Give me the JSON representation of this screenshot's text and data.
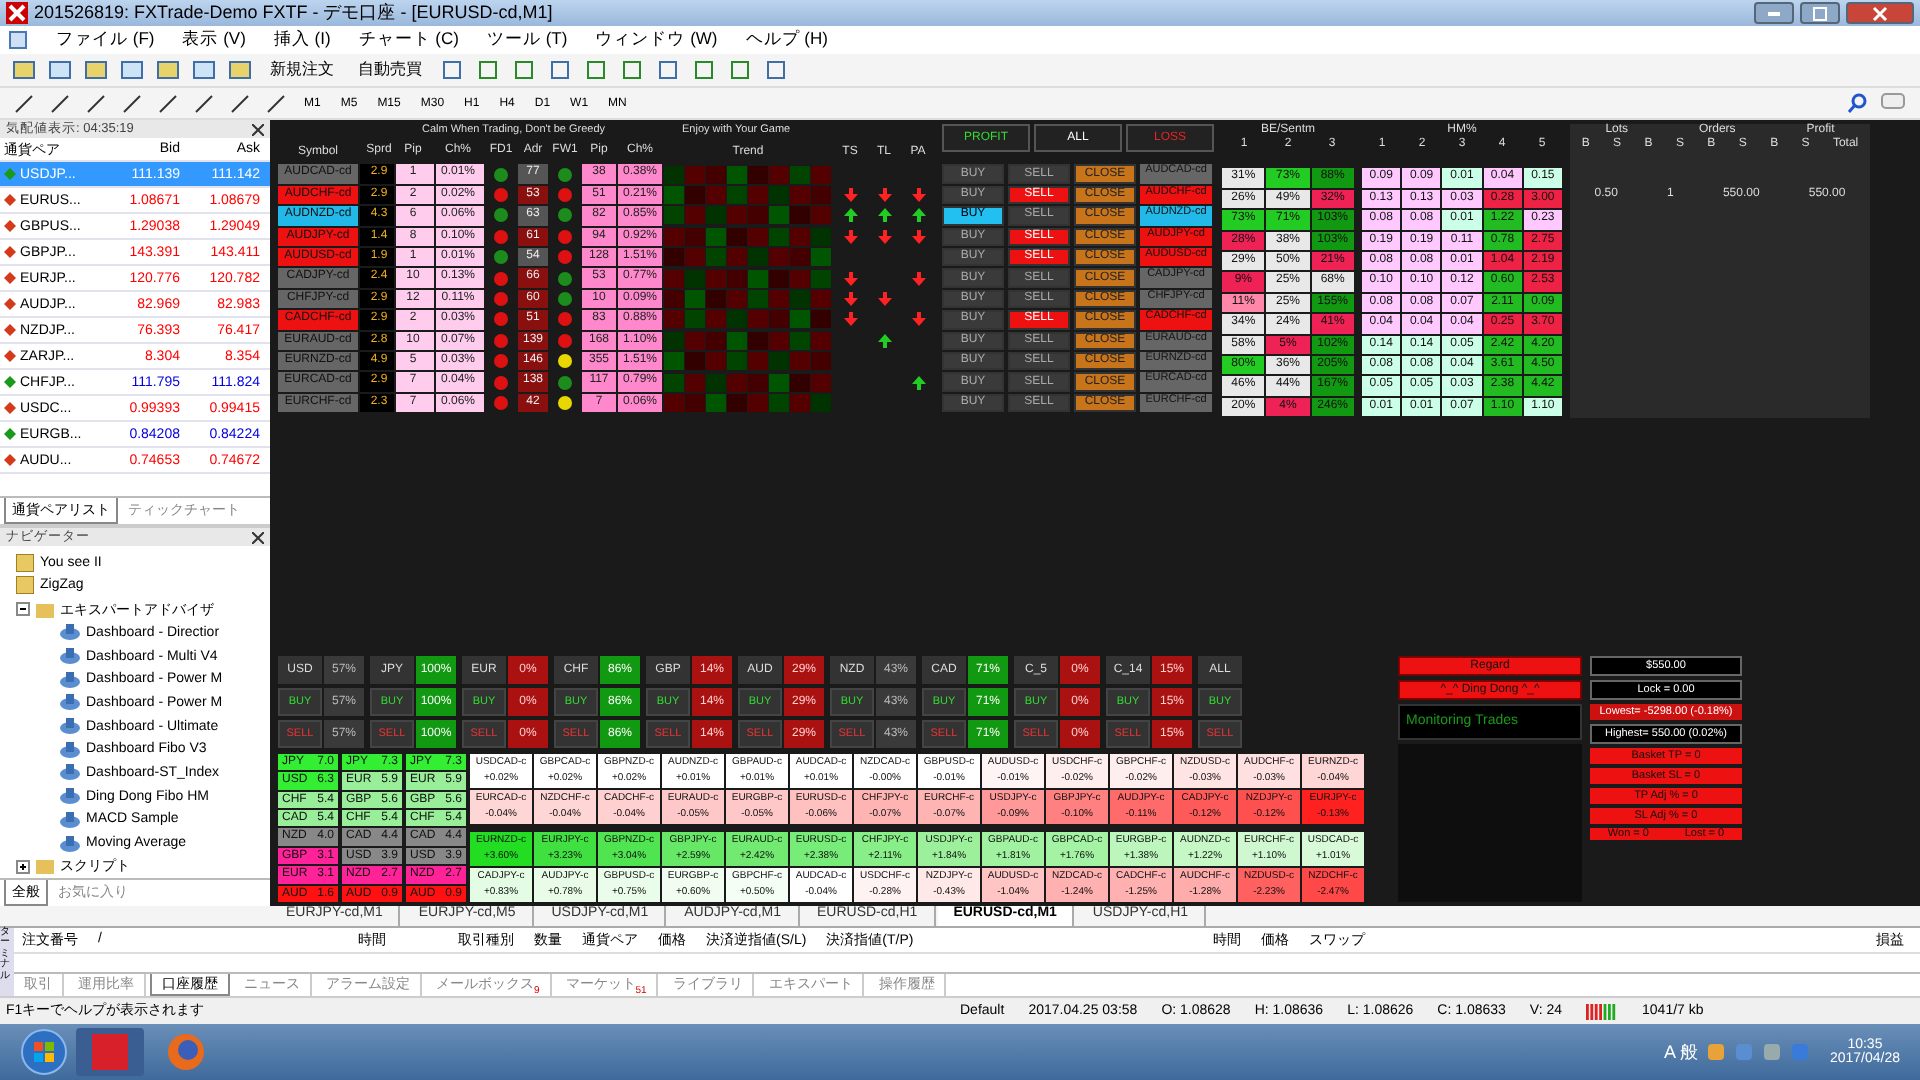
{
  "window": {
    "title": "201526819: FXTrade-Demo FXTF - デモ口座 - [EURUSD-cd,M1]"
  },
  "menu": [
    "ファイル (F)",
    "表示 (V)",
    "挿入 (I)",
    "チャート (C)",
    "ツール (T)",
    "ウィンドウ (W)",
    "ヘルプ (H)"
  ],
  "toolbar": {
    "new_order": "新規注文",
    "auto_trading": "自動売買",
    "timeframes": [
      "M1",
      "M5",
      "M15",
      "M30",
      "H1",
      "H4",
      "D1",
      "W1",
      "MN"
    ]
  },
  "market_watch": {
    "title": "気配値表示: 04:35:19",
    "columns": [
      "通貨ペア",
      "Bid",
      "Ask"
    ],
    "rows": [
      {
        "symbol": "USDJP...",
        "bid": "111.139",
        "ask": "111.142",
        "color": "#1a9a1a",
        "selected": true
      },
      {
        "symbol": "EURUS...",
        "bid": "1.08671",
        "ask": "1.08679",
        "color": "#d43a1a",
        "selected": false
      },
      {
        "symbol": "GBPUS...",
        "bid": "1.29038",
        "ask": "1.29049",
        "color": "#d43a1a",
        "selected": false
      },
      {
        "symbol": "GBPJP...",
        "bid": "143.391",
        "ask": "143.411",
        "color": "#d43a1a",
        "selected": false
      },
      {
        "symbol": "EURJP...",
        "bid": "120.776",
        "ask": "120.782",
        "color": "#d43a1a",
        "selected": false
      },
      {
        "symbol": "AUDJP...",
        "bid": "82.969",
        "ask": "82.983",
        "color": "#d43a1a",
        "selected": false
      },
      {
        "symbol": "NZDJP...",
        "bid": "76.393",
        "ask": "76.417",
        "color": "#d43a1a",
        "selected": false
      },
      {
        "symbol": "ZARJP...",
        "bid": "8.304",
        "ask": "8.354",
        "color": "#d43a1a",
        "selected": false
      },
      {
        "symbol": "CHFJP...",
        "bid": "111.795",
        "ask": "111.824",
        "color": "#1a9a1a",
        "selected": false
      },
      {
        "symbol": "USDC...",
        "bid": "0.99393",
        "ask": "0.99415",
        "color": "#d43a1a",
        "selected": false
      },
      {
        "symbol": "EURGB...",
        "bid": "0.84208",
        "ask": "0.84224",
        "color": "#1a9a1a",
        "selected": false
      },
      {
        "symbol": "AUDU...",
        "bid": "0.74653",
        "ask": "0.74672",
        "color": "#d43a1a",
        "selected": false
      }
    ],
    "tabs": [
      {
        "label": "通貨ペアリスト",
        "selected": true
      },
      {
        "label": "ティックチャート",
        "selected": false
      }
    ]
  },
  "navigator": {
    "title": "ナビゲーター",
    "items": [
      {
        "label": "You see II",
        "kind": "indicator"
      },
      {
        "label": "ZigZag",
        "kind": "indicator"
      },
      {
        "label": "エキスパートアドバイザ",
        "kind": "folder",
        "expanded": true,
        "children": [
          {
            "label": "Dashboard - Directior",
            "kind": "expert"
          },
          {
            "label": "Dashboard - Multi V4",
            "kind": "expert"
          },
          {
            "label": "Dashboard - Power M",
            "kind": "expert"
          },
          {
            "label": "Dashboard - Power M",
            "kind": "expert"
          },
          {
            "label": "Dashboard - Ultimate",
            "kind": "expert"
          },
          {
            "label": "Dashboard Fibo V3",
            "kind": "expert"
          },
          {
            "label": "Dashboard-ST_Index",
            "kind": "expert"
          },
          {
            "label": "Ding Dong Fibo HM",
            "kind": "expert"
          },
          {
            "label": "MACD Sample",
            "kind": "expert"
          },
          {
            "label": "Moving Average",
            "kind": "expert"
          }
        ]
      },
      {
        "label": "スクリプト",
        "kind": "folder",
        "expanded": false
      }
    ],
    "tabs": [
      {
        "label": "全般",
        "selected": true
      },
      {
        "label": "お気に入り",
        "selected": false
      }
    ]
  },
  "dashboard": {
    "motto_1": "Calm When Trading, Don't be Greedy",
    "motto_2": "Enjoy with Your Game",
    "columns": [
      "Symbol",
      "Sprd",
      "Pip",
      "Ch%",
      "FD1",
      "Adr",
      "FW1",
      "Pip",
      "Ch%",
      "Trend",
      "TS",
      "TL",
      "PA"
    ],
    "actions": [
      "PROFIT",
      "ALL",
      "LOSS"
    ],
    "be_header": "BE/Sentm",
    "be_cols": [
      "1",
      "2",
      "3"
    ],
    "hm_header": "HM%",
    "hm_cols": [
      "1",
      "2",
      "3",
      "4",
      "5"
    ],
    "rows": [
      {
        "symbol": "AUDCAD-cd",
        "symbol_right": "AUDCAD-cd",
        "buttons": [
          "BUY",
          "SELL",
          "CLOSE"
        ],
        "color": "#666666",
        "sprd": "2.9",
        "pip": "1",
        "ch": "0.01%",
        "fd1": {
          "color": "#1c8c1c"
        },
        "adr": "77",
        "fw1": {
          "color": "#1c8c1c"
        },
        "pip2": "38",
        "ch2": "0.38%",
        "be": [
          {
            "text": "31%",
            "color": "#e8e8e8"
          },
          {
            "text": "73%",
            "color": "#22cc22"
          },
          {
            "text": "88%",
            "color": "#119911"
          }
        ],
        "hm": [
          {
            "text": "0.09",
            "color": "#ffc8ff"
          },
          {
            "text": "0.09",
            "color": "#ffc8ff"
          },
          {
            "text": "0.01",
            "color": "#ccffe8"
          },
          {
            "text": "0.04",
            "color": "#ffc8ff"
          },
          {
            "text": "0.15",
            "color": "#ccffe8"
          }
        ]
      },
      {
        "symbol": "AUDCHF-cd",
        "symbol_right": "AUDCHF-cd",
        "buttons": [
          "BUY",
          "SELL",
          "CLOSE"
        ],
        "color": "#ee1111",
        "sprd": "2.9",
        "pip": "2",
        "ch": "0.02%",
        "fd1": {
          "color": "#dd1111"
        },
        "adr": "53",
        "fw1": {
          "color": "#dd1111"
        },
        "pip2": "51",
        "ch2": "0.21%",
        "ts": {
          "kind": "fall"
        },
        "tl": {
          "kind": "fall"
        },
        "pa": {
          "kind": "fall"
        },
        "be": [
          {
            "text": "26%",
            "color": "#e8e8e8"
          },
          {
            "text": "49%",
            "color": "#e8e8e8"
          },
          {
            "text": "32%",
            "color": "#ee2255"
          }
        ],
        "hm": [
          {
            "text": "0.13",
            "color": "#ffc8ff"
          },
          {
            "text": "0.13",
            "color": "#ffc8ff"
          },
          {
            "text": "0.03",
            "color": "#ffc8ff"
          },
          {
            "text": "0.28",
            "color": "#ee2244"
          },
          {
            "text": "3.00",
            "color": "#ee2244"
          }
        ]
      },
      {
        "symbol": "AUDNZD-cd",
        "symbol_right": "AUDNZD-cd",
        "buttons": [
          "BUY",
          "SELL",
          "CLOSE"
        ],
        "color": "#22b8e8",
        "sprd": "4.3",
        "pip": "6",
        "ch": "0.06%",
        "fd1": {
          "color": "#1c8c1c"
        },
        "adr": "63",
        "fw1": {
          "color": "#1c8c1c"
        },
        "pip2": "82",
        "ch2": "0.85%",
        "ts": {
          "kind": "rise"
        },
        "tl": {
          "kind": "rise"
        },
        "pa": {
          "kind": "rise"
        },
        "be": [
          {
            "text": "73%",
            "color": "#22cc22"
          },
          {
            "text": "71%",
            "color": "#22cc22"
          },
          {
            "text": "103%",
            "color": "#119911"
          }
        ],
        "hm": [
          {
            "text": "0.08",
            "color": "#ffc8ff"
          },
          {
            "text": "0.08",
            "color": "#ffc8ff"
          },
          {
            "text": "0.01",
            "color": "#ccffe8"
          },
          {
            "text": "1.22",
            "color": "#22bb22"
          },
          {
            "text": "0.23",
            "color": "#ffc8ff"
          }
        ]
      },
      {
        "symbol": "AUDJPY-cd",
        "symbol_right": "AUDJPY-cd",
        "buttons": [
          "BUY",
          "SELL",
          "CLOSE"
        ],
        "color": "#ee1111",
        "sprd": "1.4",
        "pip": "8",
        "ch": "0.10%",
        "fd1": {
          "color": "#dd1111"
        },
        "adr": "61",
        "fw1": {
          "color": "#dd1111"
        },
        "pip2": "94",
        "ch2": "0.92%",
        "ts": {
          "kind": "fall"
        },
        "tl": {
          "kind": "fall"
        },
        "pa": {
          "kind": "fall"
        },
        "be": [
          {
            "text": "28%",
            "color": "#ee2255"
          },
          {
            "text": "38%",
            "color": "#e8e8e8"
          },
          {
            "text": "103%",
            "color": "#119911"
          }
        ],
        "hm": [
          {
            "text": "0.19",
            "color": "#ffc8ff"
          },
          {
            "text": "0.19",
            "color": "#ffc8ff"
          },
          {
            "text": "0.11",
            "color": "#ffc8ff"
          },
          {
            "text": "0.78",
            "color": "#22bb22"
          },
          {
            "text": "2.75",
            "color": "#ee2244"
          }
        ]
      },
      {
        "symbol": "AUDUSD-cd",
        "symbol_right": "AUDUSD-cd",
        "buttons": [
          "BUY",
          "SELL",
          "CLOSE"
        ],
        "color": "#ee1111",
        "sprd": "1.9",
        "pip": "1",
        "ch": "0.01%",
        "fd1": {
          "color": "#1c8c1c"
        },
        "adr": "54",
        "fw1": {
          "color": "#dd1111"
        },
        "pip2": "128",
        "ch2": "1.51%",
        "be": [
          {
            "text": "29%",
            "color": "#e8e8e8"
          },
          {
            "text": "50%",
            "color": "#e8e8e8"
          },
          {
            "text": "21%",
            "color": "#ee2255"
          }
        ],
        "hm": [
          {
            "text": "0.08",
            "color": "#ffc8ff"
          },
          {
            "text": "0.08",
            "color": "#ffc8ff"
          },
          {
            "text": "0.01",
            "color": "#ffc8ff"
          },
          {
            "text": "1.04",
            "color": "#ee2244"
          },
          {
            "text": "2.19",
            "color": "#ee2244"
          }
        ]
      },
      {
        "symbol": "CADJPY-cd",
        "symbol_right": "CADJPY-cd",
        "buttons": [
          "BUY",
          "SELL",
          "CLOSE"
        ],
        "color": "#666666",
        "sprd": "2.4",
        "pip": "10",
        "ch": "0.13%",
        "fd1": {
          "color": "#dd1111"
        },
        "adr": "66",
        "fw1": {
          "color": "#1c8c1c"
        },
        "pip2": "53",
        "ch2": "0.77%",
        "ts": {
          "kind": "fall"
        },
        "pa": {
          "kind": "fall"
        },
        "be": [
          {
            "text": "9%",
            "color": "#ee2255"
          },
          {
            "text": "25%",
            "color": "#e8e8e8"
          },
          {
            "text": "68%",
            "color": "#e8e8e8"
          }
        ],
        "hm": [
          {
            "text": "0.10",
            "color": "#ffc8ff"
          },
          {
            "text": "0.10",
            "color": "#ffc8ff"
          },
          {
            "text": "0.12",
            "color": "#ffc8ff"
          },
          {
            "text": "0.60",
            "color": "#22bb22"
          },
          {
            "text": "2.53",
            "color": "#ee2244"
          }
        ]
      },
      {
        "symbol": "CHFJPY-cd",
        "symbol_right": "CHFJPY-cd",
        "buttons": [
          "BUY",
          "SELL",
          "CLOSE"
        ],
        "color": "#666666",
        "sprd": "2.9",
        "pip": "12",
        "ch": "0.11%",
        "fd1": {
          "color": "#dd1111"
        },
        "adr": "60",
        "fw1": {
          "color": "#1c8c1c"
        },
        "pip2": "10",
        "ch2": "0.09%",
        "ts": {
          "kind": "fall"
        },
        "tl": {
          "kind": "fall"
        },
        "be": [
          {
            "text": "11%",
            "color": "#ff88aa"
          },
          {
            "text": "25%",
            "color": "#e8e8e8"
          },
          {
            "text": "155%",
            "color": "#119911"
          }
        ],
        "hm": [
          {
            "text": "0.08",
            "color": "#ffc8ff"
          },
          {
            "text": "0.08",
            "color": "#ffc8ff"
          },
          {
            "text": "0.07",
            "color": "#ffc8ff"
          },
          {
            "text": "2.11",
            "color": "#22bb22"
          },
          {
            "text": "0.09",
            "color": "#22bb22"
          }
        ]
      },
      {
        "symbol": "CADCHF-cd",
        "symbol_right": "CADCHF-cd",
        "buttons": [
          "BUY",
          "SELL",
          "CLOSE"
        ],
        "color": "#ee1111",
        "sprd": "2.9",
        "pip": "2",
        "ch": "0.03%",
        "fd1": {
          "color": "#dd1111"
        },
        "adr": "51",
        "fw1": {
          "color": "#dd1111"
        },
        "pip2": "83",
        "ch2": "0.88%",
        "ts": {
          "kind": "fall"
        },
        "pa": {
          "kind": "fall"
        },
        "be": [
          {
            "text": "34%",
            "color": "#e8e8e8"
          },
          {
            "text": "24%",
            "color": "#e8e8e8"
          },
          {
            "text": "41%",
            "color": "#ee2255"
          }
        ],
        "hm": [
          {
            "text": "0.04",
            "color": "#ffc8ff"
          },
          {
            "text": "0.04",
            "color": "#ffc8ff"
          },
          {
            "text": "0.04",
            "color": "#ffc8ff"
          },
          {
            "text": "0.25",
            "color": "#ee2244"
          },
          {
            "text": "3.70",
            "color": "#ee2244"
          }
        ]
      },
      {
        "symbol": "EURAUD-cd",
        "symbol_right": "EURAUD-cd",
        "buttons": [
          "BUY",
          "SELL",
          "CLOSE"
        ],
        "color": "#666666",
        "sprd": "2.8",
        "pip": "10",
        "ch": "0.07%",
        "fd1": {
          "color": "#dd1111"
        },
        "adr": "139",
        "fw1": {
          "color": "#dd1111"
        },
        "pip2": "168",
        "ch2": "1.10%",
        "tl": {
          "kind": "rise"
        },
        "be": [
          {
            "text": "58%",
            "color": "#e8e8e8"
          },
          {
            "text": "5%",
            "color": "#ee2255"
          },
          {
            "text": "102%",
            "color": "#119911"
          }
        ],
        "hm": [
          {
            "text": "0.14",
            "color": "#ccffe8"
          },
          {
            "text": "0.14",
            "color": "#ccffe8"
          },
          {
            "text": "0.05",
            "color": "#ccffe8"
          },
          {
            "text": "2.42",
            "color": "#22bb22"
          },
          {
            "text": "4.20",
            "color": "#22bb22"
          }
        ]
      },
      {
        "symbol": "EURNZD-cd",
        "symbol_right": "EURNZD-cd",
        "buttons": [
          "BUY",
          "SELL",
          "CLOSE"
        ],
        "color": "#666666",
        "sprd": "4.9",
        "pip": "5",
        "ch": "0.03%",
        "fd1": {
          "color": "#dd1111"
        },
        "adr": "146",
        "fw1": {
          "color": "#e8d800"
        },
        "pip2": "355",
        "ch2": "1.51%",
        "be": [
          {
            "text": "80%",
            "color": "#22cc22"
          },
          {
            "text": "36%",
            "color": "#e8e8e8"
          },
          {
            "text": "205%",
            "color": "#119911"
          }
        ],
        "hm": [
          {
            "text": "0.08",
            "color": "#ccffe8"
          },
          {
            "text": "0.08",
            "color": "#ccffe8"
          },
          {
            "text": "0.04",
            "color": "#ccffe8"
          },
          {
            "text": "3.61",
            "color": "#22bb22"
          },
          {
            "text": "4.50",
            "color": "#22bb22"
          }
        ]
      },
      {
        "symbol": "EURCAD-cd",
        "symbol_right": "EURCAD-cd",
        "buttons": [
          "BUY",
          "SELL",
          "CLOSE"
        ],
        "color": "#666666",
        "sprd": "2.9",
        "pip": "7",
        "ch": "0.04%",
        "fd1": {
          "color": "#dd1111"
        },
        "adr": "138",
        "fw1": {
          "color": "#1c8c1c"
        },
        "pip2": "117",
        "ch2": "0.79%",
        "pa": {
          "kind": "rise"
        },
        "be": [
          {
            "text": "46%",
            "color": "#e8e8e8"
          },
          {
            "text": "44%",
            "color": "#e8e8e8"
          },
          {
            "text": "167%",
            "color": "#119911"
          }
        ],
        "hm": [
          {
            "text": "0.05",
            "color": "#ccffe8"
          },
          {
            "text": "0.05",
            "color": "#ccffe8"
          },
          {
            "text": "0.03",
            "color": "#ccffe8"
          },
          {
            "text": "2.38",
            "color": "#22bb22"
          },
          {
            "text": "4.42",
            "color": "#22bb22"
          }
        ]
      },
      {
        "symbol": "EURCHF-cd",
        "symbol_right": "EURCHF-cd",
        "buttons": [
          "BUY",
          "SELL",
          "CLOSE"
        ],
        "color": "#666666",
        "sprd": "2.3",
        "pip": "7",
        "ch": "0.06%",
        "fd1": {
          "color": "#dd1111"
        },
        "adr": "42",
        "fw1": {
          "color": "#e8d800"
        },
        "pip2": "7",
        "ch2": "0.06%",
        "be": [
          {
            "text": "20%",
            "color": "#e8e8e8"
          },
          {
            "text": "4%",
            "color": "#ee2255"
          },
          {
            "text": "246%",
            "color": "#119911"
          }
        ],
        "hm": [
          {
            "text": "0.01",
            "color": "#ccffe8"
          },
          {
            "text": "0.01",
            "color": "#ccffe8"
          },
          {
            "text": "0.07",
            "color": "#ccffe8"
          },
          {
            "text": "1.10",
            "color": "#22bb22"
          },
          {
            "text": "1.10",
            "color": "#ccffe8"
          }
        ]
      }
    ],
    "account_headers": {
      "lots": "Lots",
      "orders": "Orders",
      "profit": "Profit",
      "total": "Total",
      "sides": [
        "B",
        "S",
        "B",
        "S",
        "B",
        "S",
        "B",
        "S"
      ]
    },
    "account_row": {
      "lots": "0.50",
      "orders": "1",
      "profit": "550.00",
      "total": "550.00"
    },
    "strength": [
      {
        "currency": "USD",
        "values": [
          "57%",
          "57%",
          "57%"
        ],
        "color": "#3a3a3a",
        "buttons": [
          "BUY",
          "SELL"
        ]
      },
      {
        "currency": "JPY",
        "values": [
          "100%",
          "100%",
          "100%"
        ],
        "color": "#119911",
        "buttons": [
          "BUY",
          "SELL"
        ]
      },
      {
        "currency": "EUR",
        "values": [
          "0%",
          "0%",
          "0%"
        ],
        "color": "#aa1111",
        "buttons": [
          "BUY",
          "SELL"
        ]
      },
      {
        "currency": "CHF",
        "values": [
          "86%",
          "86%",
          "86%"
        ],
        "color": "#119911",
        "buttons": [
          "BUY",
          "SELL"
        ]
      },
      {
        "currency": "GBP",
        "values": [
          "14%",
          "14%",
          "14%"
        ],
        "color": "#aa1111",
        "buttons": [
          "BUY",
          "SELL"
        ]
      },
      {
        "currency": "AUD",
        "values": [
          "29%",
          "29%",
          "29%"
        ],
        "color": "#aa1111",
        "buttons": [
          "BUY",
          "SELL"
        ]
      },
      {
        "currency": "NZD",
        "values": [
          "43%",
          "43%",
          "43%"
        ],
        "color": "#3a3a3a",
        "buttons": [
          "BUY",
          "SELL"
        ]
      },
      {
        "currency": "CAD",
        "values": [
          "71%",
          "71%",
          "71%"
        ],
        "color": "#119911",
        "buttons": [
          "BUY",
          "SELL"
        ]
      },
      {
        "currency": "C_5",
        "values": [
          "0%",
          "0%",
          "0%"
        ],
        "color": "#aa1111",
        "buttons": [
          "BUY",
          "SELL"
        ]
      },
      {
        "currency": "C_14",
        "values": [
          "15%",
          "15%",
          "15%"
        ],
        "color": "#aa1111",
        "buttons": [
          "BUY",
          "SELL"
        ]
      }
    ],
    "all_group": {
      "label": "ALL",
      "buttons": [
        "BUY",
        "SELL"
      ]
    },
    "side_buttons": [
      {
        "label": "Regard",
        "kind": "alert"
      },
      {
        "label": "^_^ Ding Dong ^_^",
        "kind": "alert"
      },
      {
        "label": "Monitoring Trades",
        "kind": "status"
      }
    ],
    "ranking": [
      [
        {
          "cur": "JPY",
          "val": "7.0",
          "color": "#33ee33"
        },
        {
          "cur": "USD",
          "val": "6.3",
          "color": "#33ee33"
        },
        {
          "cur": "CHF",
          "val": "5.4",
          "color": "#99ee99"
        },
        {
          "cur": "CAD",
          "val": "5.4",
          "color": "#99ee99"
        },
        {
          "cur": "NZD",
          "val": "4.0",
          "color": "#888888"
        },
        {
          "cur": "GBP",
          "val": "3.1",
          "color": "#ff2299"
        },
        {
          "cur": "EUR",
          "val": "3.1",
          "color": "#ff2299"
        },
        {
          "cur": "AUD",
          "val": "1.6",
          "color": "#ff1111"
        }
      ],
      [
        {
          "cur": "JPY",
          "val": "7.3",
          "color": "#33ee33"
        },
        {
          "cur": "EUR",
          "val": "5.9",
          "color": "#99ee99"
        },
        {
          "cur": "GBP",
          "val": "5.6",
          "color": "#99ee99"
        },
        {
          "cur": "CHF",
          "val": "5.4",
          "color": "#99ee99"
        },
        {
          "cur": "CAD",
          "val": "4.4",
          "color": "#888888"
        },
        {
          "cur": "USD",
          "val": "3.9",
          "color": "#888888"
        },
        {
          "cur": "NZD",
          "val": "2.7",
          "color": "#ff2299"
        },
        {
          "cur": "AUD",
          "val": "0.9",
          "color": "#ff1111"
        }
      ],
      [
        {
          "cur": "JPY",
          "val": "7.3",
          "color": "#33ee33"
        },
        {
          "cur": "EUR",
          "val": "5.9",
          "color": "#99ee99"
        },
        {
          "cur": "GBP",
          "val": "5.6",
          "color": "#99ee99"
        },
        {
          "cur": "CHF",
          "val": "5.4",
          "color": "#99ee99"
        },
        {
          "cur": "CAD",
          "val": "4.4",
          "color": "#888888"
        },
        {
          "cur": "USD",
          "val": "3.9",
          "color": "#888888"
        },
        {
          "cur": "NZD",
          "val": "2.7",
          "color": "#ff2299"
        },
        {
          "cur": "AUD",
          "val": "0.9",
          "color": "#ff1111"
        }
      ]
    ],
    "pair_grid": [
      [
        {
          "pair": "USDCAD-c",
          "chg": "+0.02%",
          "color": "#ffffff"
        },
        {
          "pair": "GBPCAD-c",
          "chg": "+0.02%",
          "color": "#ffffff"
        },
        {
          "pair": "GBPNZD-c",
          "chg": "+0.02%",
          "color": "#ffffff"
        },
        {
          "pair": "AUDNZD-c",
          "chg": "+0.01%",
          "color": "#ffffff"
        },
        {
          "pair": "GBPAUD-c",
          "chg": "+0.01%",
          "color": "#ffffff"
        },
        {
          "pair": "AUDCAD-c",
          "chg": "+0.01%",
          "color": "#ffffff"
        },
        {
          "pair": "NZDCAD-c",
          "chg": "-0.00%",
          "color": "#ffffff"
        },
        {
          "pair": "GBPUSD-c",
          "chg": "-0.01%",
          "color": "#ffffff"
        },
        {
          "pair": "AUDUSD-c",
          "chg": "-0.01%",
          "color": "#fff4f4"
        },
        {
          "pair": "USDCHF-c",
          "chg": "-0.02%",
          "color": "#ffeeee"
        },
        {
          "pair": "GBPCHF-c",
          "chg": "-0.02%",
          "color": "#ffeeee"
        },
        {
          "pair": "NZDUSD-c",
          "chg": "-0.03%",
          "color": "#ffe4e4"
        },
        {
          "pair": "AUDCHF-c",
          "chg": "-0.03%",
          "color": "#ffe0e0"
        },
        {
          "pair": "EURNZD-c",
          "chg": "-0.04%",
          "color": "#ffd6d6"
        }
      ],
      [
        {
          "pair": "EURCAD-c",
          "chg": "-0.04%",
          "color": "#ffd6d6"
        },
        {
          "pair": "NZDCHF-c",
          "chg": "-0.04%",
          "color": "#ffd6d6"
        },
        {
          "pair": "CADCHF-c",
          "chg": "-0.04%",
          "color": "#ffd0d0"
        },
        {
          "pair": "EURAUD-c",
          "chg": "-0.05%",
          "color": "#ffc8c8"
        },
        {
          "pair": "EURGBP-c",
          "chg": "-0.05%",
          "color": "#ffc8c8"
        },
        {
          "pair": "EURUSD-c",
          "chg": "-0.06%",
          "color": "#ffc0c0"
        },
        {
          "pair": "CHFJPY-c",
          "chg": "-0.07%",
          "color": "#ffb4b4"
        },
        {
          "pair": "EURCHF-c",
          "chg": "-0.07%",
          "color": "#ffb4b4"
        },
        {
          "pair": "USDJPY-c",
          "chg": "-0.09%",
          "color": "#ff9898"
        },
        {
          "pair": "GBPJPY-c",
          "chg": "-0.10%",
          "color": "#ff8080"
        },
        {
          "pair": "AUDJPY-c",
          "chg": "-0.11%",
          "color": "#ff6a6a"
        },
        {
          "pair": "CADJPY-c",
          "chg": "-0.12%",
          "color": "#ff5a5a"
        },
        {
          "pair": "NZDJPY-c",
          "chg": "-0.12%",
          "color": "#ff5050"
        },
        {
          "pair": "EURJPY-c",
          "chg": "-0.13%",
          "color": "#ff2020"
        }
      ],
      [
        {
          "pair": "EURNZD-c",
          "chg": "+3.60%",
          "color": "#22dd22"
        },
        {
          "pair": "EURJPY-c",
          "chg": "+3.23%",
          "color": "#40e040"
        },
        {
          "pair": "GBPNZD-c",
          "chg": "+3.04%",
          "color": "#50e450"
        },
        {
          "pair": "GBPJPY-c",
          "chg": "+2.59%",
          "color": "#66e866"
        },
        {
          "pair": "EURAUD-c",
          "chg": "+2.42%",
          "color": "#72ea72"
        },
        {
          "pair": "EURUSD-c",
          "chg": "+2.38%",
          "color": "#78ec78"
        },
        {
          "pair": "CHFJPY-c",
          "chg": "+2.11%",
          "color": "#88ee88"
        },
        {
          "pair": "USDJPY-c",
          "chg": "+1.84%",
          "color": "#9cf09c"
        },
        {
          "pair": "GBPAUD-c",
          "chg": "+1.81%",
          "color": "#a0f2a0"
        },
        {
          "pair": "GBPCAD-c",
          "chg": "+1.76%",
          "color": "#a4f2a4"
        },
        {
          "pair": "EURGBP-c",
          "chg": "+1.38%",
          "color": "#bcf6bc"
        },
        {
          "pair": "AUDNZD-c",
          "chg": "+1.22%",
          "color": "#c6f8c6"
        },
        {
          "pair": "EURCHF-c",
          "chg": "+1.10%",
          "color": "#d0f8d0"
        },
        {
          "pair": "USDCAD-c",
          "chg": "+1.01%",
          "color": "#d8fad8"
        }
      ],
      [
        {
          "pair": "CADJPY-c",
          "chg": "+0.83%",
          "color": "#e4fce4"
        },
        {
          "pair": "AUDJPY-c",
          "chg": "+0.78%",
          "color": "#e8fce8"
        },
        {
          "pair": "GBPUSD-c",
          "chg": "+0.75%",
          "color": "#eafcea"
        },
        {
          "pair": "EURGBP-c",
          "chg": "+0.60%",
          "color": "#f0fdf0"
        },
        {
          "pair": "GBPCHF-c",
          "chg": "+0.50%",
          "color": "#f4fef4"
        },
        {
          "pair": "AUDCAD-c",
          "chg": "-0.04%",
          "color": "#ffffff"
        },
        {
          "pair": "USDCHF-c",
          "chg": "-0.28%",
          "color": "#fff2f2"
        },
        {
          "pair": "NZDJPY-c",
          "chg": "-0.43%",
          "color": "#ffe8e8"
        },
        {
          "pair": "AUDUSD-c",
          "chg": "-1.04%",
          "color": "#ffc4c4"
        },
        {
          "pair": "NZDCAD-c",
          "chg": "-1.24%",
          "color": "#ffb0b0"
        },
        {
          "pair": "CADCHF-c",
          "chg": "-1.25%",
          "color": "#ffb0b0"
        },
        {
          "pair": "AUDCHF-c",
          "chg": "-1.28%",
          "color": "#ffacac"
        },
        {
          "pair": "NZDUSD-c",
          "chg": "-2.23%",
          "color": "#ff6060"
        },
        {
          "pair": "NZDCHF-c",
          "chg": "-2.47%",
          "color": "#ff4848"
        }
      ]
    ],
    "summary": [
      {
        "text": "$550.00",
        "kind": "box"
      },
      {
        "text": "Lock = 0.00",
        "kind": "box"
      },
      {
        "text": "Lowest= -5298.00 (-0.18%)",
        "kind": "loss"
      },
      {
        "text": "Highest= 550.00 (0.02%)",
        "kind": "box"
      },
      {
        "text": "Basket TP = 0",
        "kind": "alert"
      },
      {
        "text": "Basket SL = 0",
        "kind": "alert"
      },
      {
        "text": "TP Adj % = 0",
        "kind": "alert"
      },
      {
        "text": "SL Adj % = 0",
        "kind": "alert"
      }
    ],
    "won": "Won = 0",
    "lost": "Lost = 0"
  },
  "chart_tabs": [
    {
      "label": "EURJPY-cd,M1",
      "selected": false
    },
    {
      "label": "EURJPY-cd,M5",
      "selected": false
    },
    {
      "label": "USDJPY-cd,M1",
      "selected": false
    },
    {
      "label": "AUDJPY-cd,M1",
      "selected": false
    },
    {
      "label": "EURUSD-cd,H1",
      "selected": false
    },
    {
      "label": "EURUSD-cd,M1",
      "selected": true
    },
    {
      "label": "USDJPY-cd,H1",
      "selected": false
    }
  ],
  "terminal": {
    "side_label": "ターミナル",
    "columns": [
      "注文番号",
      "/",
      "時間",
      "取引種別",
      "数量",
      "通貨ペア",
      "価格",
      "決済逆指値(S/L)",
      "決済指値(T/P)",
      "時間",
      "価格",
      "スワップ",
      "損益"
    ],
    "tabs": [
      {
        "label": "取引",
        "selected": false
      },
      {
        "label": "運用比率",
        "selected": false
      },
      {
        "label": "口座履歴",
        "selected": true
      },
      {
        "label": "ニュース",
        "selected": false
      },
      {
        "label": "アラーム設定",
        "selected": false
      },
      {
        "label": "メールボックス",
        "badge": "9",
        "selected": false
      },
      {
        "label": "マーケット",
        "badge": "51",
        "selected": false
      },
      {
        "label": "ライブラリ",
        "selected": false
      },
      {
        "label": "エキスパート",
        "selected": false
      },
      {
        "label": "操作履歴",
        "selected": false
      }
    ]
  },
  "status_bar": {
    "help": "F1キーでヘルプが表示されます",
    "profile": "Default",
    "time": "2017.04.25 03:58",
    "open": "O: 1.08628",
    "high": "H: 1.08636",
    "low": "L: 1.08626",
    "close": "C: 1.08633",
    "volume": "V: 24",
    "traffic": "1041/7 kb"
  },
  "taskbar": {
    "ime": "A 般",
    "time": "10:35",
    "date": "2017/04/28"
  }
}
